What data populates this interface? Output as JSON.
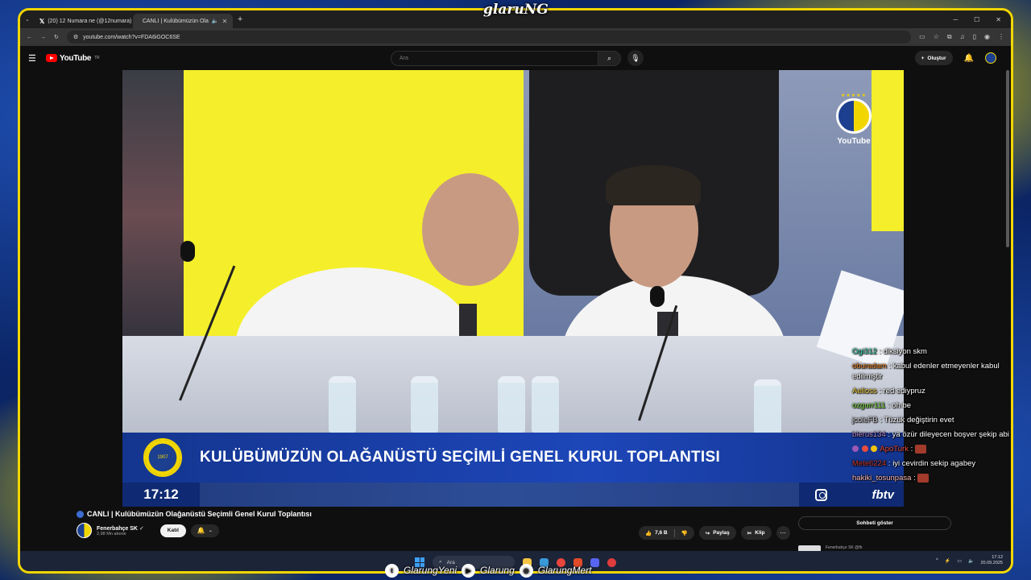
{
  "overlay": {
    "streamer_logo": "glaruNG",
    "socials": [
      {
        "icon": "twitter-icon",
        "label": "GlarungYeni"
      },
      {
        "icon": "youtube-icon",
        "label": "Glarung"
      },
      {
        "icon": "instagram-icon",
        "label": "GlarungMert"
      }
    ]
  },
  "browser": {
    "tabs": [
      {
        "label": "(20) 12 Numara ne (@12numara)",
        "favicon": "x-icon",
        "active": false
      },
      {
        "label": "CANLI | Kulübümüzün Ola",
        "favicon": "youtube-icon",
        "active": true
      }
    ],
    "url": "youtube.com/watch?v=FDA6iGOC6SE"
  },
  "youtube": {
    "logo_text": "YouTube",
    "logo_region": "TR",
    "search_placeholder": "Ara",
    "create_label": "Oluştur"
  },
  "video": {
    "lower_third_title": "KULÜBÜMÜZÜN OLAĞANÜSTÜ SEÇİMLİ GENEL KURUL TOPLANTISI",
    "clock": "17:12",
    "brand": "fbtv",
    "watermark": "YouTube",
    "crest_year": "1907"
  },
  "chat": [
    {
      "user": "Ogi312",
      "color": "#3fd6b0",
      "text": "diksiyon skm"
    },
    {
      "user": "oburadam",
      "color": "#e67e22",
      "text": "kabul edenler etmeyenler kabul edilmiştir"
    },
    {
      "user": "Aelioss",
      "color": "#f4d03f",
      "text": "red ediypruz"
    },
    {
      "user": "ozgurr111",
      "color": "#7ddc3f",
      "text": "oh be"
    },
    {
      "user": "jcoleFB",
      "color": "#d0d0d0",
      "text": "Tüzük değiştirin evet"
    },
    {
      "user": "blerus134",
      "color": "#bb8fce",
      "text": "ya özür dileyecen boşver şekip abi"
    },
    {
      "user": "ApoTurk",
      "color": "#e74c3c",
      "text": "",
      "emote": true,
      "badges": true
    },
    {
      "user": "Mete6224",
      "color": "#c0392b",
      "text": "iyi cevirdin sekip agabey"
    },
    {
      "user": "hakiki_tosunpasa",
      "color": "#f5b7b1",
      "text": "",
      "emote": true
    }
  ],
  "info": {
    "title": "CANLI | Kulübümüzün Olağanüstü Seçimli Genel Kurul Toplantısı",
    "channel": "Fenerbahçe SK",
    "subs": "2,98 Mn abone",
    "join_label": "Katıl",
    "likes": "7,6 B",
    "share_label": "Paylaş",
    "clip_label": "Klip",
    "show_chat_label": "Sohbeti göster",
    "next_channel": "Fenerbahçe SK @fb"
  },
  "taskbar": {
    "search_placeholder": "Ara",
    "time": "17:12",
    "date": "20.09.2025"
  },
  "colors": {
    "fb_yellow": "#f2d600",
    "fb_navy": "#1c3f8f"
  }
}
